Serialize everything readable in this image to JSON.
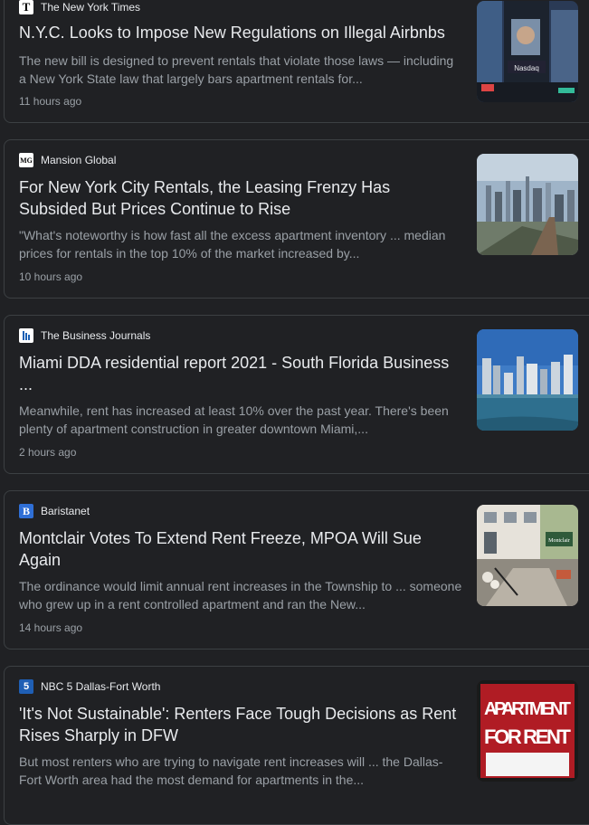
{
  "articles": [
    {
      "source": "The New York Times",
      "favicon_icon": "nyt-logo-icon",
      "headline_lines": [
        "N.Y.C. Looks to Impose New Regulations on Illegal Airbnbs"
      ],
      "snippet_lines": [
        "The new bill is designed to prevent rentals that violate those laws — including",
        "a New York State law that largely bars apartment rentals for..."
      ],
      "time": "11 hours ago"
    },
    {
      "source": "Mansion Global",
      "favicon_icon": "mansion-global-logo-icon",
      "headline_lines": [
        "For New York City Rentals, the Leasing Frenzy Has",
        "Subsided But Prices Continue to Rise"
      ],
      "snippet_lines": [
        "\"What's noteworthy is how fast all the excess apartment inventory ... median",
        "prices for rentals in the top 10% of the market increased by..."
      ],
      "time": "10 hours ago"
    },
    {
      "source": "The Business Journals",
      "favicon_icon": "business-journals-logo-icon",
      "headline_lines": [
        "Miami DDA residential report 2021 - South Florida Business",
        "..."
      ],
      "snippet_lines": [
        "Meanwhile, rent has increased at least 10% over the past year. There's been",
        "plenty of apartment construction in greater downtown Miami,..."
      ],
      "time": "2 hours ago"
    },
    {
      "source": "Baristanet",
      "favicon_icon": "baristanet-logo-icon",
      "headline_lines": [
        "Montclair Votes To Extend Rent Freeze, MPOA Will Sue",
        "Again"
      ],
      "snippet_lines": [
        "The ordinance would limit annual rent increases in the Township to ... someone",
        "who grew up in a rent controlled apartment and ran the New..."
      ],
      "time": "14 hours ago"
    },
    {
      "source": "NBC 5 Dallas-Fort Worth",
      "favicon_icon": "nbc5-logo-icon",
      "headline_lines": [
        "'It's Not Sustainable': Renters Face Tough Decisions as Rent",
        "Rises Sharply in DFW"
      ],
      "snippet_lines": [
        "But most renters who are trying to navigate rent increases will ... the Dallas-",
        "Fort Worth area had the most demand for apartments in the..."
      ],
      "time": ""
    }
  ],
  "favicon_text": {
    "nyt": "T",
    "mansion": "MG",
    "bizjournals": "",
    "baristanet": "B",
    "nbc": "5"
  },
  "thumb_text": {
    "nasdaq": "Nasdaq",
    "montclair": "Montclair",
    "sign_line1": "APARTMENT",
    "sign_line2": "FOR RENT"
  }
}
